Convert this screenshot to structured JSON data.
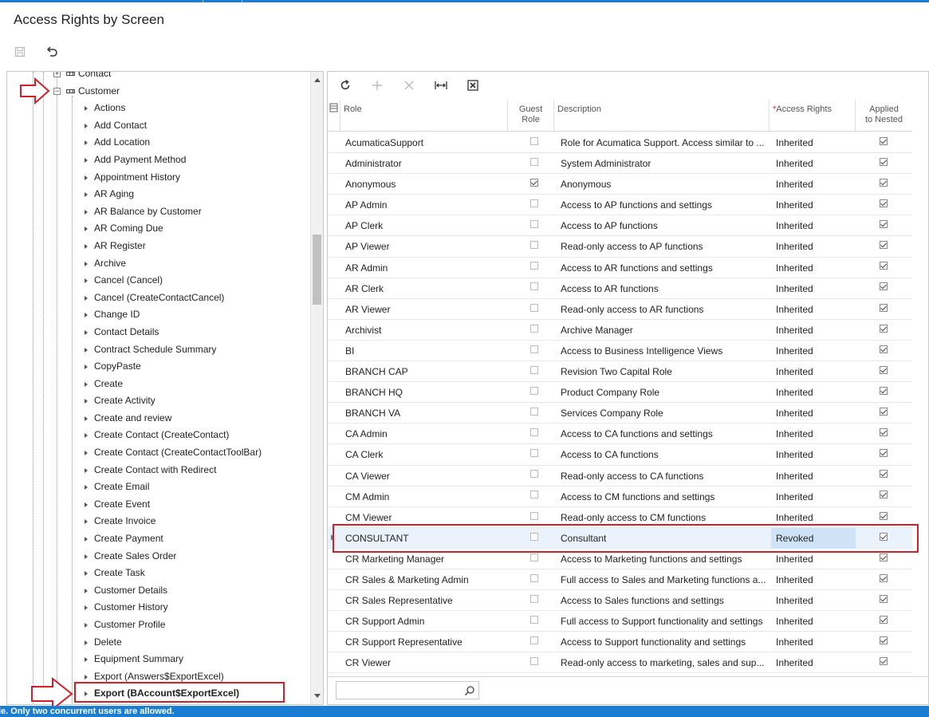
{
  "page": {
    "title": "Access Rights by Screen"
  },
  "toolbar": {
    "save_icon": "save-icon",
    "undo_icon": "undo-icon"
  },
  "tree": {
    "partial_top": "Contact",
    "parent": "Customer",
    "items": [
      "Actions",
      "Add Contact",
      "Add Location",
      "Add Payment Method",
      "Appointment History",
      "AR Aging",
      "AR Balance by Customer",
      "AR Coming Due",
      "AR Register",
      "Archive",
      "Cancel (Cancel)",
      "Cancel (CreateContactCancel)",
      "Change ID",
      "Contact Details",
      "Contract Schedule Summary",
      "CopyPaste",
      "Create",
      "Create Activity",
      "Create and review",
      "Create Contact (CreateContact)",
      "Create Contact (CreateContactToolBar)",
      "Create Contact with Redirect",
      "Create Email",
      "Create Event",
      "Create Invoice",
      "Create Payment",
      "Create Sales Order",
      "Create Task",
      "Customer Details",
      "Customer History",
      "Customer Profile",
      "Delete",
      "Equipment Summary",
      "Export (Answers$ExportExcel)",
      "Export (BAccount$ExportExcel)"
    ],
    "selected_index": 34
  },
  "grid": {
    "toolbar": {
      "refresh_icon": "refresh-icon",
      "add_icon": "add-icon",
      "delete_icon": "delete-icon",
      "fit_icon": "fit-columns-icon",
      "excel_icon": "export-excel-icon"
    },
    "columns": {
      "role": "Role",
      "guest_line1": "Guest",
      "guest_line2": "Role",
      "description": "Description",
      "access_required": "*",
      "access": "Access Rights",
      "applied_line1": "Applied",
      "applied_line2": "to Nested"
    },
    "rows": [
      {
        "role": "AcumaticaSupport",
        "guest": false,
        "description": "Role for Acumatica Support. Access similar to ...",
        "access": "Inherited",
        "applied": true
      },
      {
        "role": "Administrator",
        "guest": false,
        "description": "System Administrator",
        "access": "Inherited",
        "applied": true
      },
      {
        "role": "Anonymous",
        "guest": true,
        "description": "Anonymous",
        "access": "Inherited",
        "applied": true
      },
      {
        "role": "AP Admin",
        "guest": false,
        "description": "Access to AP functions and settings",
        "access": "Inherited",
        "applied": true
      },
      {
        "role": "AP Clerk",
        "guest": false,
        "description": "Access to AP functions",
        "access": "Inherited",
        "applied": true
      },
      {
        "role": "AP Viewer",
        "guest": false,
        "description": "Read-only access to AP functions",
        "access": "Inherited",
        "applied": true
      },
      {
        "role": "AR Admin",
        "guest": false,
        "description": "Access to AR functions and settings",
        "access": "Inherited",
        "applied": true
      },
      {
        "role": "AR Clerk",
        "guest": false,
        "description": "Access to AR functions",
        "access": "Inherited",
        "applied": true
      },
      {
        "role": "AR Viewer",
        "guest": false,
        "description": "Read-only access to AR functions",
        "access": "Inherited",
        "applied": true
      },
      {
        "role": "Archivist",
        "guest": false,
        "description": "Archive Manager",
        "access": "Inherited",
        "applied": true
      },
      {
        "role": "BI",
        "guest": false,
        "description": "Access to Business Intelligence Views",
        "access": "Inherited",
        "applied": true
      },
      {
        "role": "BRANCH CAP",
        "guest": false,
        "description": "Revision Two Capital Role",
        "access": "Inherited",
        "applied": true
      },
      {
        "role": "BRANCH HQ",
        "guest": false,
        "description": "Product Company Role",
        "access": "Inherited",
        "applied": true
      },
      {
        "role": "BRANCH VA",
        "guest": false,
        "description": "Services Company Role",
        "access": "Inherited",
        "applied": true
      },
      {
        "role": "CA Admin",
        "guest": false,
        "description": "Access to CA functions and settings",
        "access": "Inherited",
        "applied": true
      },
      {
        "role": "CA Clerk",
        "guest": false,
        "description": "Access to CA functions",
        "access": "Inherited",
        "applied": true
      },
      {
        "role": "CA Viewer",
        "guest": false,
        "description": "Read-only access to CA functions",
        "access": "Inherited",
        "applied": true
      },
      {
        "role": "CM Admin",
        "guest": false,
        "description": "Access to CM functions and settings",
        "access": "Inherited",
        "applied": true
      },
      {
        "role": "CM Viewer",
        "guest": false,
        "description": "Read-only access to CM functions",
        "access": "Inherited",
        "applied": true
      },
      {
        "role": "CONSULTANT",
        "guest": false,
        "description": "Consultant",
        "access": "Revoked",
        "applied": true,
        "selected": true
      },
      {
        "role": "CR Marketing Manager",
        "guest": false,
        "description": "Access to Marketing functions and settings",
        "access": "Inherited",
        "applied": true
      },
      {
        "role": "CR Sales & Marketing Admin",
        "guest": false,
        "description": "Full access to Sales and Marketing functions a...",
        "access": "Inherited",
        "applied": true
      },
      {
        "role": "CR Sales Representative",
        "guest": false,
        "description": "Access to Sales functions and settings",
        "access": "Inherited",
        "applied": true
      },
      {
        "role": "CR Support Admin",
        "guest": false,
        "description": "Full access to Support functionality and settings",
        "access": "Inherited",
        "applied": true
      },
      {
        "role": "CR Support Representative",
        "guest": false,
        "description": "Access to Support functionality and settings",
        "access": "Inherited",
        "applied": true
      },
      {
        "role": "CR Viewer",
        "guest": false,
        "description": "Read-only access to marketing, sales and sup...",
        "access": "Inherited",
        "applied": true
      }
    ],
    "search": {
      "value": "",
      "placeholder": "",
      "icon": "search-icon"
    }
  },
  "status": {
    "message": "le. Only two concurrent users are allowed."
  },
  "colors": {
    "accent": "#1a7dd4",
    "annotation": "#d0202a",
    "selected_row": "#eaf3fb",
    "selected_cell": "#cfe3f6"
  }
}
